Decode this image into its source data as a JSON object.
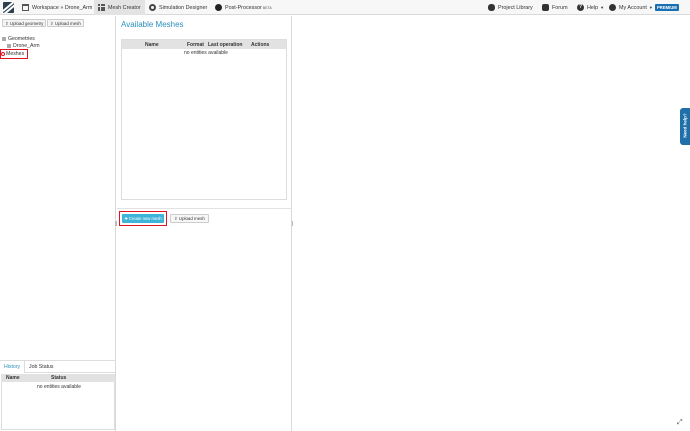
{
  "nav": {
    "workspace": "Workspace » Drone_Arm",
    "mesh_creator": "Mesh Creator",
    "simulation_designer": "Simulation Designer",
    "post_processor": "Post-Processor",
    "beta": "BETA",
    "project_library": "Project Library",
    "forum": "Forum",
    "help": "Help",
    "my_account": "My Account",
    "premium": "PREMIUM"
  },
  "left": {
    "upload_geometry": "Upload geometry",
    "upload_mesh": "Upload mesh",
    "tree": {
      "geometries": "Geometries",
      "drone_arm": "Drone_Arm",
      "meshes": "Meshes"
    },
    "tabs": [
      "History",
      "Job Status"
    ],
    "table": {
      "headers": [
        "Name",
        "Status"
      ],
      "empty": "no entities available"
    }
  },
  "main": {
    "title": "Available Meshes",
    "table": {
      "headers": [
        "Name",
        "Format",
        "Last operation",
        "Actions"
      ],
      "empty": "no entities available"
    },
    "create_button": "Create new mesh",
    "upload_button": "Upload mesh"
  },
  "viewer": {
    "need_help": "Need help?"
  },
  "colors": {
    "accent": "#2a8fbd",
    "create_button": "#3eb4d8",
    "highlight": "#e0141e",
    "need_help": "#1f6fa8"
  }
}
